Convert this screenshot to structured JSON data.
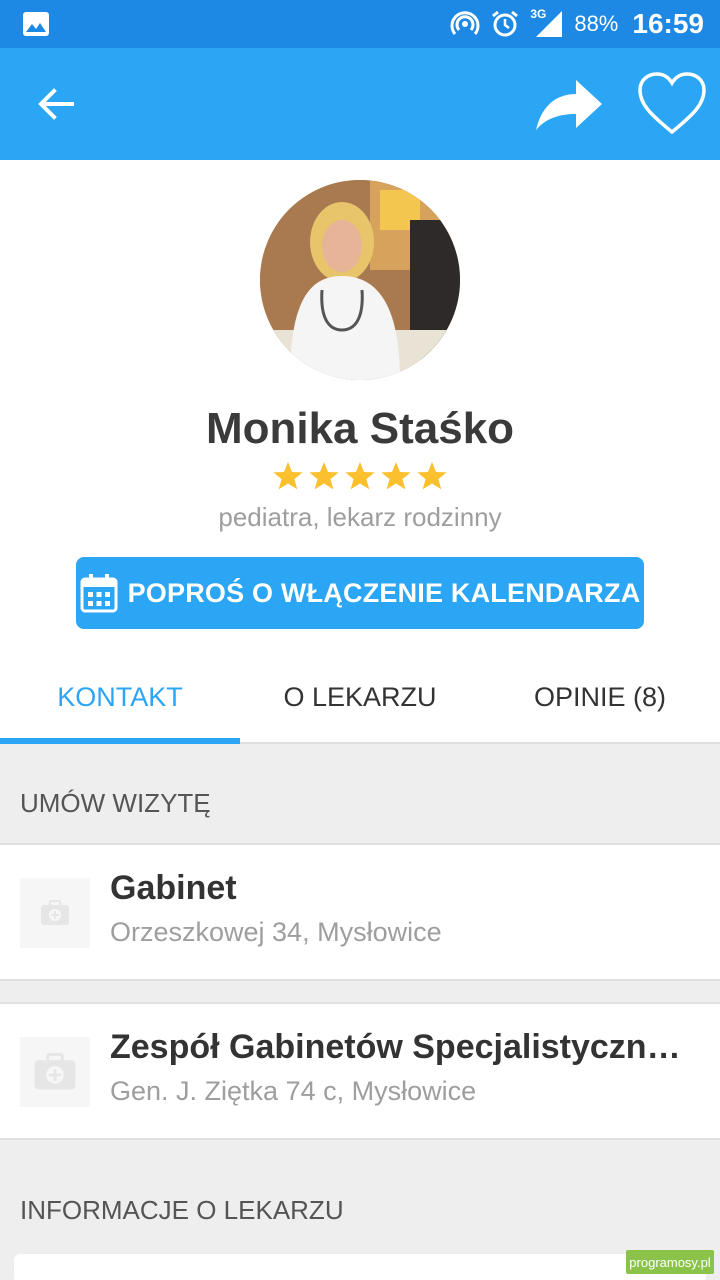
{
  "status_bar": {
    "network": "3G",
    "battery": "88%",
    "time": "16:59",
    "icons": [
      "image-icon",
      "hotspot-icon",
      "alarm-icon",
      "signal-icon"
    ]
  },
  "toolbar": {
    "back_icon": "back-arrow-icon",
    "share_icon": "share-icon",
    "favorite_icon": "heart-outline-icon"
  },
  "profile": {
    "name": "Monika Staśko",
    "rating": 5,
    "rating_max": 5,
    "specialty": "pediatra, lekarz rodzinny",
    "calendar_button": "POPROŚ O WŁĄCZENIE KALENDARZA"
  },
  "tabs": [
    {
      "label": "KONTAKT",
      "active": true
    },
    {
      "label": "O LEKARZU",
      "active": false
    },
    {
      "label": "OPINIE (8)",
      "active": false
    }
  ],
  "sections": {
    "appointments": "UMÓW WIZYTĘ",
    "doctor_info": "INFORMACJE O LEKARZU"
  },
  "locations": [
    {
      "title": "Gabinet",
      "address": "Orzeszkowej 34, Mysłowice",
      "icon": "medical-bag-icon"
    },
    {
      "title": "Zespół Gabinetów Specjalistyczny...",
      "address": "Gen. J. Ziętka 74 c, Mysłowice",
      "icon": "medical-bag-icon"
    }
  ],
  "watermark": "programosy.pl",
  "colors": {
    "status_bar": "#1e88e5",
    "primary": "#2aa6f4",
    "star": "#fbc02d",
    "background": "#eeeeee"
  }
}
